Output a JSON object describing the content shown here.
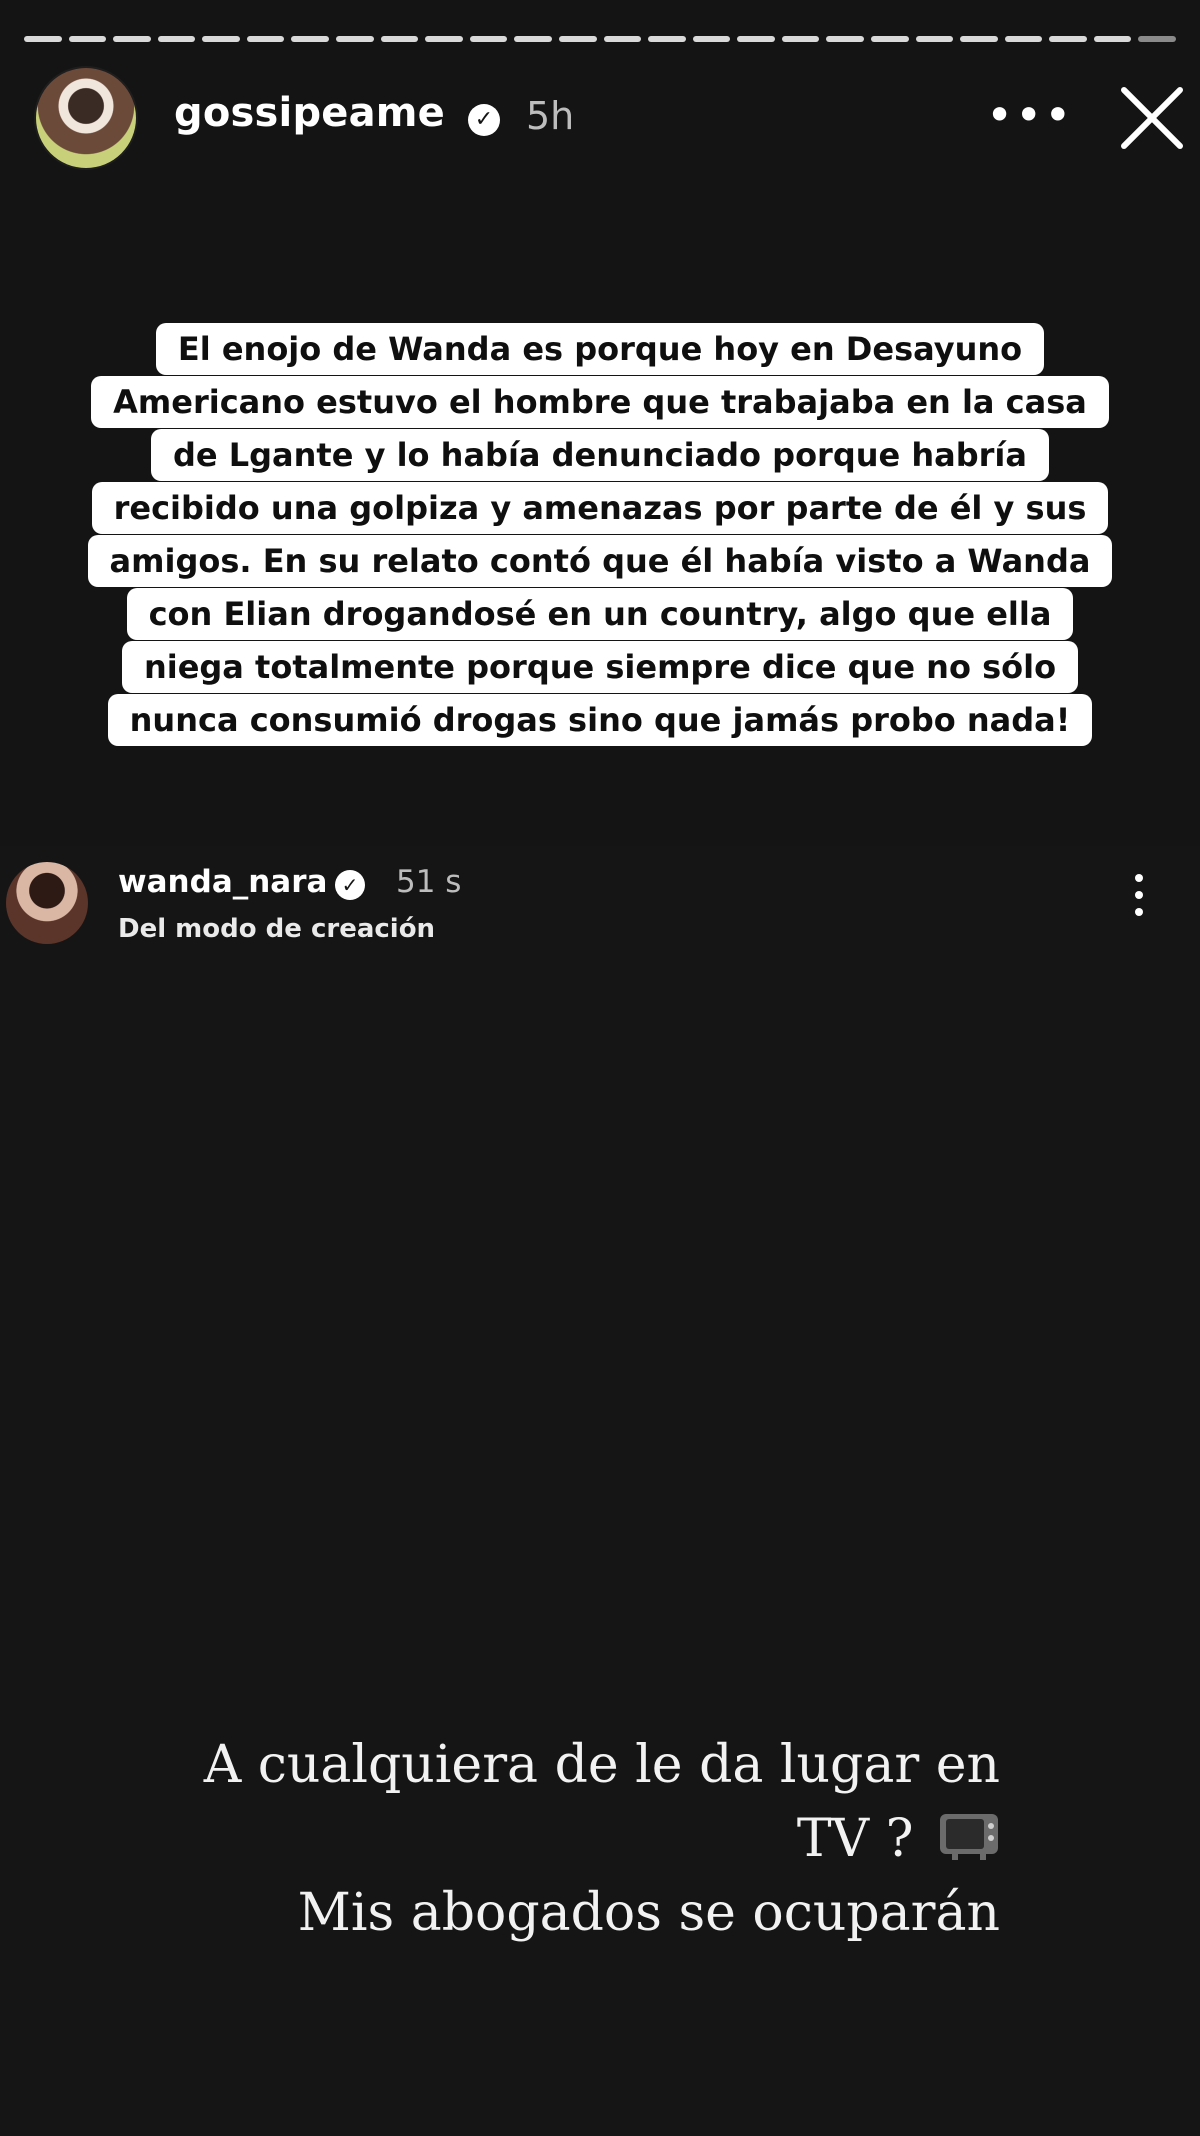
{
  "story": {
    "segments_total": 26,
    "segments_viewed": 25
  },
  "header": {
    "username": "gossipeame",
    "verified": true,
    "time": "5h",
    "more_icon": "ellipsis-horizontal-icon",
    "close_icon": "close-icon"
  },
  "overlay_text": {
    "lines": [
      "El enojo de Wanda es porque hoy en Desayuno",
      "Americano estuvo el hombre que trabajaba en la casa",
      "de Lgante y lo había denunciado porque habría",
      "recibido una golpiza y amenazas por parte de él y sus",
      "amigos. En su relato contó que él había visto a Wanda",
      "con Elian drogandosé en un country, algo que ella",
      "niega totalmente porque siempre dice que no sólo",
      "nunca consumió drogas sino que jamás probo nada!"
    ]
  },
  "repost": {
    "username": "wanda_nara",
    "verified": true,
    "time": "51 s",
    "subtitle": "Del modo de creación",
    "more_icon": "ellipsis-vertical-icon",
    "caption_line1": "A cualquiera de le da lugar en",
    "caption_line2": "TV ?",
    "caption_line3": "Mis abogados se ocuparán",
    "caption_emoji": "television-icon"
  },
  "colors": {
    "background": "#141414",
    "text_box": "#ffffff"
  }
}
